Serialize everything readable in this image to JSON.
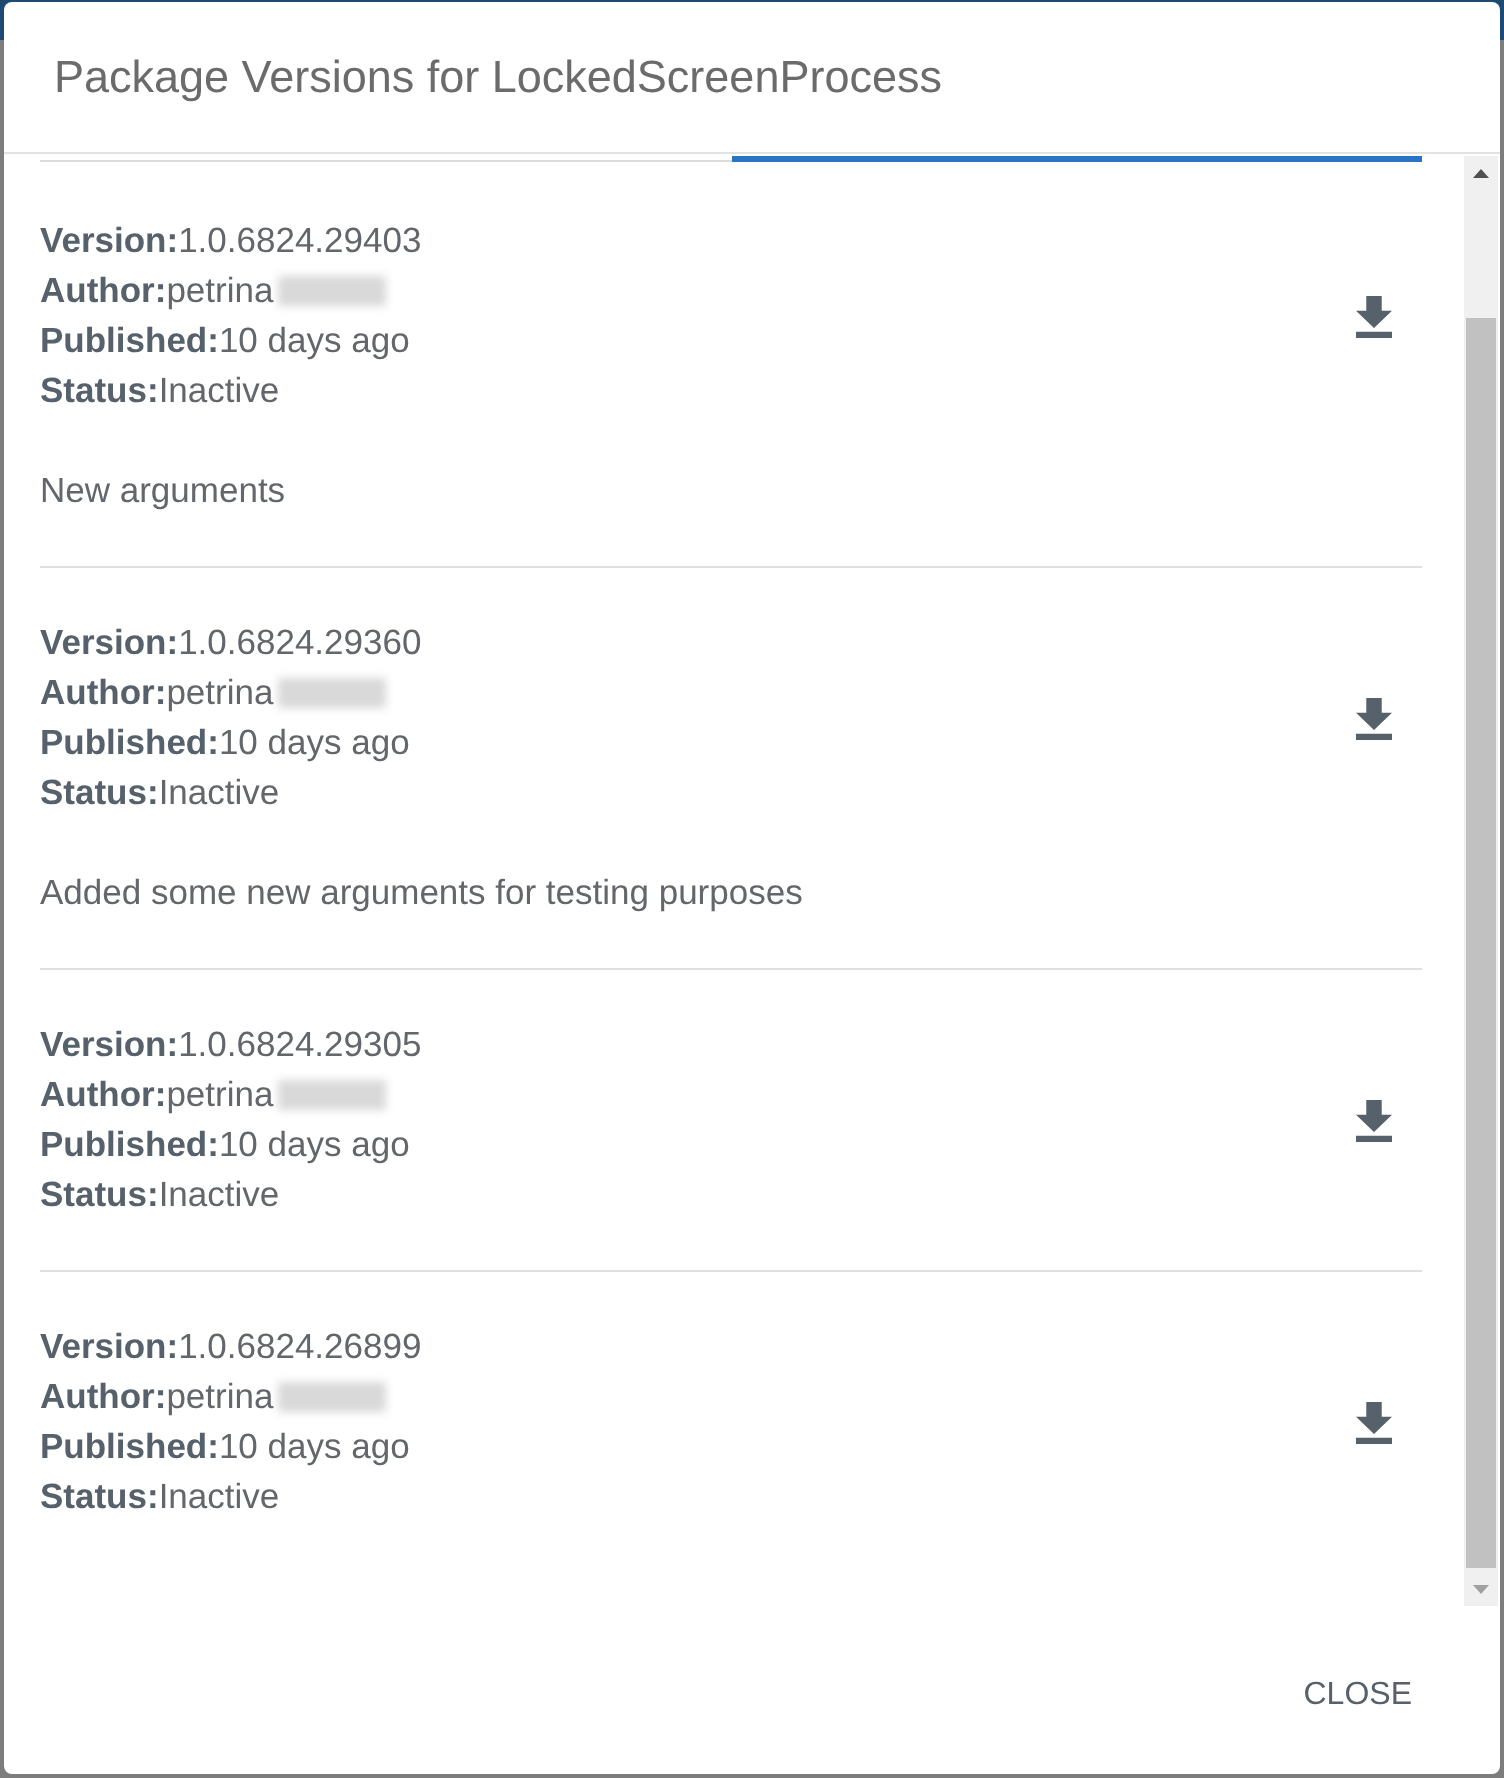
{
  "dialog": {
    "title": "Package Versions for LockedScreenProcess"
  },
  "tabs": [
    {
      "selected": false
    },
    {
      "selected": true
    }
  ],
  "versions": [
    {
      "fields": [
        {
          "label": "Version:",
          "value": "1.0.6824.29403",
          "redacted": false
        },
        {
          "label": "Author:",
          "value": "petrina",
          "redacted": true
        },
        {
          "label": "Published:",
          "value": "10 days ago",
          "redacted": false
        },
        {
          "label": "Status:",
          "value": "Inactive",
          "redacted": false
        }
      ],
      "description": "New arguments"
    },
    {
      "fields": [
        {
          "label": "Version:",
          "value": "1.0.6824.29360",
          "redacted": false
        },
        {
          "label": "Author:",
          "value": "petrina",
          "redacted": true
        },
        {
          "label": "Published:",
          "value": "10 days ago",
          "redacted": false
        },
        {
          "label": "Status:",
          "value": "Inactive",
          "redacted": false
        }
      ],
      "description": "Added some new arguments for testing purposes"
    },
    {
      "fields": [
        {
          "label": "Version:",
          "value": "1.0.6824.29305",
          "redacted": false
        },
        {
          "label": "Author:",
          "value": "petrina",
          "redacted": true
        },
        {
          "label": "Published:",
          "value": "10 days ago",
          "redacted": false
        },
        {
          "label": "Status:",
          "value": "Inactive",
          "redacted": false
        }
      ]
    },
    {
      "fields": [
        {
          "label": "Version:",
          "value": "1.0.6824.26899",
          "redacted": false
        },
        {
          "label": "Author:",
          "value": "petrina",
          "redacted": true
        },
        {
          "label": "Published:",
          "value": "10 days ago",
          "redacted": false
        },
        {
          "label": "Status:",
          "value": "Inactive",
          "redacted": false
        }
      ]
    }
  ],
  "buttons": [
    {
      "label": "CLOSE"
    }
  ]
}
